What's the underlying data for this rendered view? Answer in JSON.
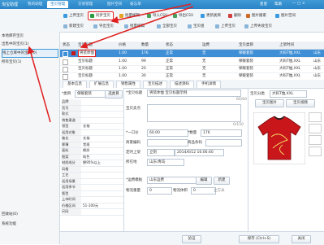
{
  "window": {
    "app_title": "淘宝助理",
    "right_user": "星星",
    "right_help": "帮助",
    "window_controls": "— □ ×"
  },
  "top_tabs": [
    "我的助理",
    "宝贝管理",
    "交易管理",
    "图片空间",
    "备忘单"
  ],
  "toolbar": {
    "buttons": [
      "上传宝贝",
      "同步宝贝",
      "批量编辑",
      "导入CSV",
      "导出CSV",
      "更新类目",
      "删除",
      "图片搬家",
      "图片空间",
      "删除店铺"
    ],
    "sub_buttons": [
      "新建宝贝",
      "导出宝贝",
      "批量编辑",
      "全部宝贝",
      "宝贝组",
      "上传宝贝",
      "上传失败宝贝"
    ]
  },
  "sidebar": {
    "items": [
      "本地库存宝贝",
      "出售中的宝贝(1)",
      "线上仓库中的宝贝(0)",
      "所有宝贝(1)"
    ],
    "bottom": [
      "回收站(0)",
      "系统功能"
    ]
  },
  "grid": {
    "headers": [
      "状态",
      "宝贝标题",
      "价格",
      "数量",
      "状态",
      "运费",
      "宝贝类目",
      "上架时间"
    ],
    "rows": [
      {
        "title": "男装体恤",
        "price": "1.00",
        "qty": "176",
        "state": "正常",
        "shipping": "无",
        "category": "保暖套装",
        "listing": "大码T恤,XXL",
        "extra": "山东"
      },
      {
        "title": "宝贝标题",
        "price": "1.00",
        "qty": "99",
        "state": "正常",
        "shipping": "无",
        "category": "保暖套装",
        "listing": "大码T恤,XXL",
        "extra": "山东"
      },
      {
        "title": "宝贝标题",
        "price": "1.00",
        "qty": "20",
        "state": "正常",
        "shipping": "无",
        "category": "保暖套装",
        "listing": "大码T恤,XXL",
        "extra": "山东"
      },
      {
        "title": "宝贝标题",
        "price": "1.00",
        "qty": "30",
        "state": "正常",
        "shipping": "无",
        "category": "保暖套装",
        "listing": "大码T恤,XXL",
        "extra": "山东"
      }
    ]
  },
  "detail_tabs": [
    "基本信息",
    "扩展信息",
    "销售属性",
    "宝贝描述",
    "描述源码",
    "手机详情"
  ],
  "props": {
    "category_label": "*类目",
    "category_value": "保暖套装",
    "choose": "选类目",
    "rows": [
      [
        "品牌",
        ""
      ],
      [
        "货号",
        ""
      ],
      [
        "款式",
        ""
      ],
      [
        "销售渠道",
        ""
      ],
      [
        "领型",
        "长袖"
      ],
      [
        "适用对象",
        ""
      ],
      [
        "袖长",
        "长袖"
      ],
      [
        "厚薄",
        "常规"
      ],
      [
        "面料",
        "棉质"
      ],
      [
        "图案",
        "纯色"
      ],
      [
        "材质成分",
        "棉95%以上"
      ],
      [
        "风格",
        ""
      ],
      [
        "工艺",
        ""
      ],
      [
        "适用场景",
        ""
      ],
      [
        "适用季节",
        ""
      ],
      [
        "版型",
        ""
      ],
      [
        "上市时间",
        ""
      ],
      [
        "价格区间",
        "51-100元"
      ],
      [
        "尺码",
        ""
      ]
    ]
  },
  "form": {
    "title_label": "*宝贝标题",
    "title_value": "男装体恤 宝贝标题示例",
    "counter": "60/60",
    "sell_point_label": "宝贝卖点",
    "sell_counter": "0/150",
    "price_label": "*一口价",
    "price_value": "60.00",
    "qty_label": "*数量",
    "qty_value": "176",
    "code_label": "商家编码",
    "barcode_label": "商品条码",
    "time_label": "定时上架",
    "time_mode": "立刻",
    "time_value": "2014/6/12 16:06:40",
    "location_label": "所在地",
    "location_value": "山东/青岛",
    "ship_label": "*运费模板",
    "ship_value": "山东运费",
    "edit": "编辑",
    "new": "新建",
    "weight_label": "物流重量",
    "weight_value": "0",
    "volume_label": "物流体积",
    "volume_value": "0",
    "unit": "立方米"
  },
  "image_panel": {
    "tab_images": "宝贝图片",
    "tab_video": "宝贝视频",
    "category_label": "宝贝分类",
    "category_value": "大码T恤,XXL"
  },
  "bottom": {
    "validate": "验证",
    "save": "保存 (Ctrl+S)",
    "close": "关闭"
  },
  "colors": {
    "accent": "#2a84c6",
    "highlight_red": "#e02020",
    "selected_row": "#3f8fd6",
    "shirt_red": "#c8161b"
  }
}
